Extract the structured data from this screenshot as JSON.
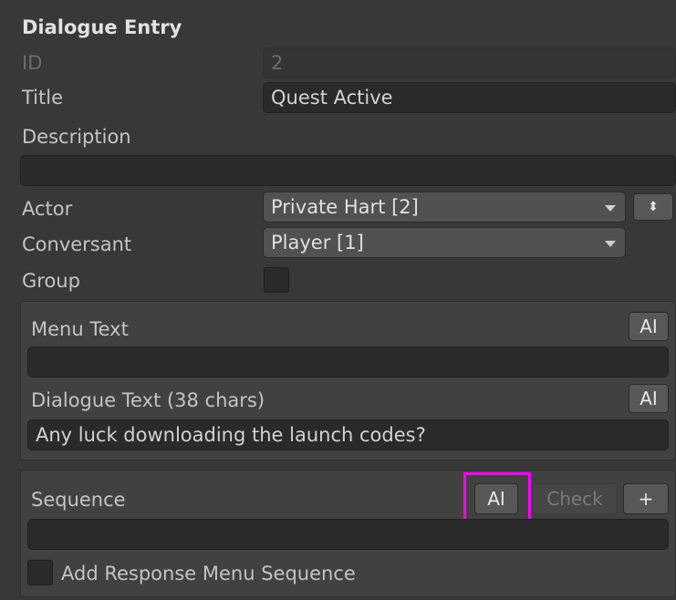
{
  "header": {
    "title": "Dialogue Entry"
  },
  "fields": {
    "id": {
      "label": "ID",
      "value": "2"
    },
    "title": {
      "label": "Title",
      "value": "Quest Active"
    },
    "description": {
      "label": "Description",
      "value": ""
    },
    "actor": {
      "label": "Actor",
      "value": "Private Hart [2]"
    },
    "conversant": {
      "label": "Conversant",
      "value": "Player [1]"
    },
    "group": {
      "label": "Group",
      "checked": false
    }
  },
  "text_section": {
    "menu_text": {
      "label": "Menu Text",
      "ai_label": "AI",
      "value": ""
    },
    "dialogue_text": {
      "label": "Dialogue Text (38 chars)",
      "ai_label": "AI",
      "value": "Any luck downloading the launch codes?"
    }
  },
  "sequence_section": {
    "label": "Sequence",
    "ai_label": "AI",
    "check_label": "Check",
    "add_label": "+",
    "value": "",
    "response_menu": {
      "label": "Add Response Menu Sequence",
      "checked": false
    }
  },
  "colors": {
    "highlight": "#ff00ff"
  },
  "icons": {
    "actor_swap": "updown-arrows-icon",
    "dropdown": "triangle-down-icon"
  }
}
